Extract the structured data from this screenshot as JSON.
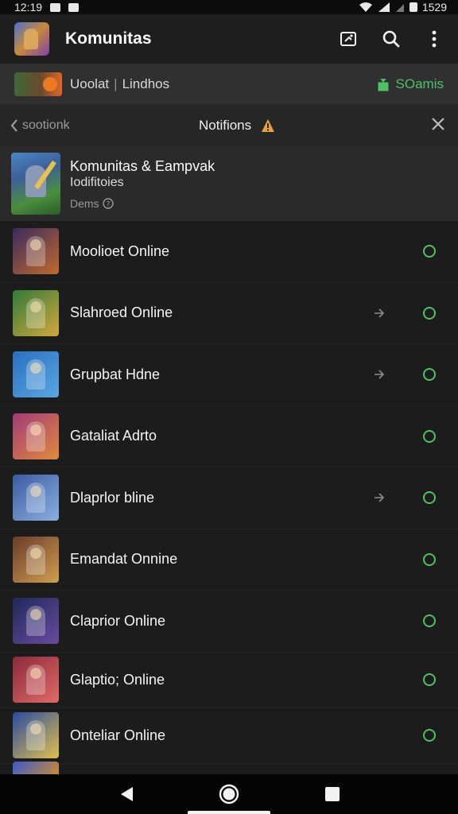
{
  "status_bar": {
    "time": "12:19",
    "battery": "1529"
  },
  "app_bar": {
    "title": "Komunitas",
    "icons": [
      "image-frame-icon",
      "search-icon",
      "more-vert-icon"
    ]
  },
  "banner": {
    "text_left": "Uoolat",
    "separator": "|",
    "text_right": "Lindhos",
    "badge": "SOamis",
    "badge_color": "#4cc265"
  },
  "notifications_header": {
    "back_label": "sootionk",
    "title": "Notifions",
    "warning_color": "#e6a23c"
  },
  "featured": {
    "title": "Komunitas & Eampvak",
    "subtitle": "Iodifitoies",
    "meta": "Dems"
  },
  "items": [
    {
      "label": "Moolioet Online",
      "arrow": false,
      "colors": [
        "#3b2a60",
        "#c06a2a"
      ]
    },
    {
      "label": "Slahroed Online",
      "arrow": true,
      "colors": [
        "#2f7a3a",
        "#d3a83a"
      ]
    },
    {
      "label": "Grupbat Hdne",
      "arrow": true,
      "colors": [
        "#2a6fc0",
        "#5aa7e0"
      ]
    },
    {
      "label": "Gataliat Adrto",
      "arrow": false,
      "colors": [
        "#a23a7a",
        "#e08a3a"
      ]
    },
    {
      "label": "Dlaprlor bline",
      "arrow": true,
      "colors": [
        "#3a5aa0",
        "#8ab0e0"
      ]
    },
    {
      "label": "Emandat Onnine",
      "arrow": false,
      "colors": [
        "#6a3a2a",
        "#d0a050"
      ]
    },
    {
      "label": "Claprior Online",
      "arrow": false,
      "colors": [
        "#1e2a5a",
        "#6a4aa0"
      ]
    },
    {
      "label": "Glaptio; Online",
      "arrow": false,
      "colors": [
        "#8a2a3a",
        "#e06a6a"
      ]
    },
    {
      "label": "Onteliar Online",
      "arrow": false,
      "colors": [
        "#2a4aa0",
        "#e0c04a"
      ]
    }
  ],
  "status_color": "#4cc265"
}
